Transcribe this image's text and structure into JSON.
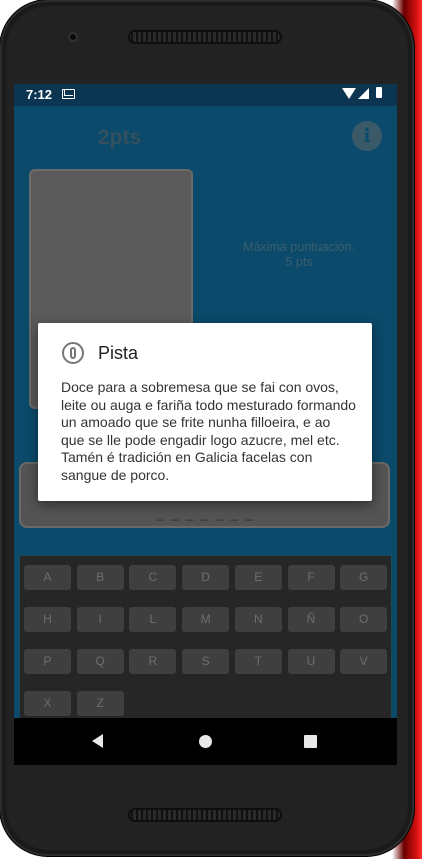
{
  "status_bar": {
    "time": "7:12"
  },
  "game": {
    "score": "2pts",
    "max_score_line1": "Máxima puntuación.",
    "max_score_line2": "5 pts",
    "answer_placeholder": "_ _ _ _ _ _ _"
  },
  "keyboard": {
    "rows": [
      [
        "A",
        "B",
        "C",
        "D",
        "E",
        "F",
        "G"
      ],
      [
        "H",
        "I",
        "L",
        "M",
        "N",
        "Ñ",
        "O"
      ],
      [
        "P",
        "Q",
        "R",
        "S",
        "T",
        "U",
        "V"
      ],
      [
        "X",
        "Z"
      ]
    ]
  },
  "dialog": {
    "title": "Pista",
    "body": "Doce para a sobremesa que se fai con ovos, leite ou auga e fariña todo mesturado formando un amoado que se frite nunha filloeira, e ao que se lle pode engadir logo azucre, mel etc. Tamén é tradición en Galicia facelas con sangue de porco."
  },
  "icons": [
    "mail-icon",
    "wifi-icon",
    "signal-icon",
    "battery-icon",
    "info-icon",
    "hint-icon",
    "back-icon",
    "home-icon",
    "recents-icon"
  ]
}
